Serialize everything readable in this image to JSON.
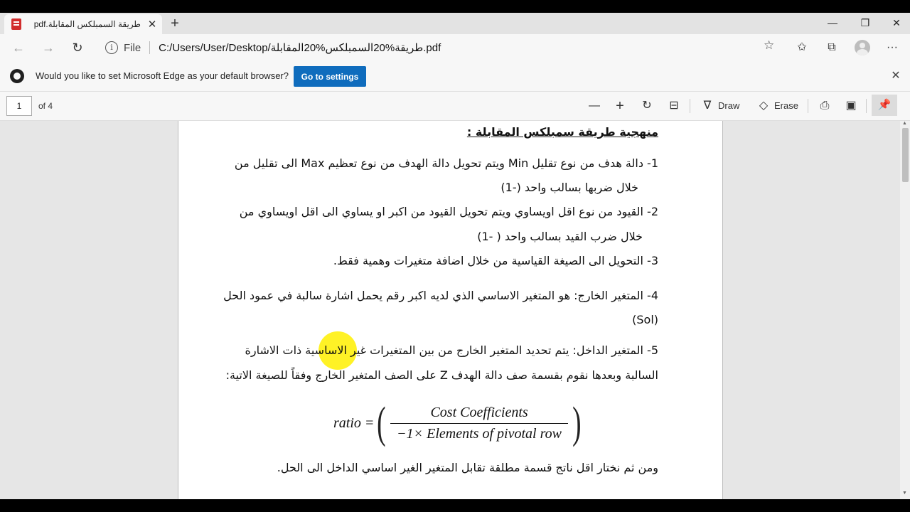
{
  "browser": {
    "tab_title": "pdf.طريقة السمبلكس المقابلة",
    "tab_close": "✕",
    "new_tab": "+",
    "window_controls": [
      "—",
      "❐",
      "✕"
    ],
    "address": {
      "file_label": "File",
      "url": "C:/Users/User/Desktop/طريقة%20السمبلكس%20المقابلة.pdf"
    }
  },
  "infobar": {
    "message": "Would you like to set Microsoft Edge as your default browser?",
    "button_label": "Go to settings"
  },
  "pdf_toolbar": {
    "page_number": "1",
    "page_count": "of 4",
    "draw_label": "Draw",
    "erase_label": "Erase"
  },
  "document": {
    "heading": "منهجية طريقة سمبلكس المقابلة :",
    "lines": [
      "1- دالة هدف من نوع تقليل Min ويتم تحويل دالة الهدف من نوع تعظيم Max الى تقليل من",
      "خلال ضربها بسالب واحد (-1)",
      "2- القيود من نوع اقل اويساوي ويتم تحويل القيود من اكبر او يساوي الى اقل اويساوي من",
      "خلال ضرب القيد بسالب واحد ( -1)",
      "3- التحويل الى الصيغة القياسية من خلال اضافة متغيرات وهمية فقط.",
      "4- المتغير الخارج: هو المتغير الاساسي الذي لديه اكبر رقم يحمل اشارة سالبة في عمود الحل",
      "(Sol)",
      "5- المتغير الداخل: يتم تحديد المتغير الخارج من بين المتغيرات غير الاساسية ذات الاشارة",
      "السالبة وبعدها نقوم بقسمة صف دالة الهدف Z على الصف المتغير الخارج وفقاً للصيغة الاتية:",
      "ومن ثم نختار اقل ناتج قسمة مطلقة تقابل المتغير الغير اساسي الداخل الى الحل."
    ],
    "formula": {
      "lhs": "ratio =",
      "numerator": "Cost Coefficients",
      "denominator": "−1× Elements of  pivotal row"
    }
  }
}
